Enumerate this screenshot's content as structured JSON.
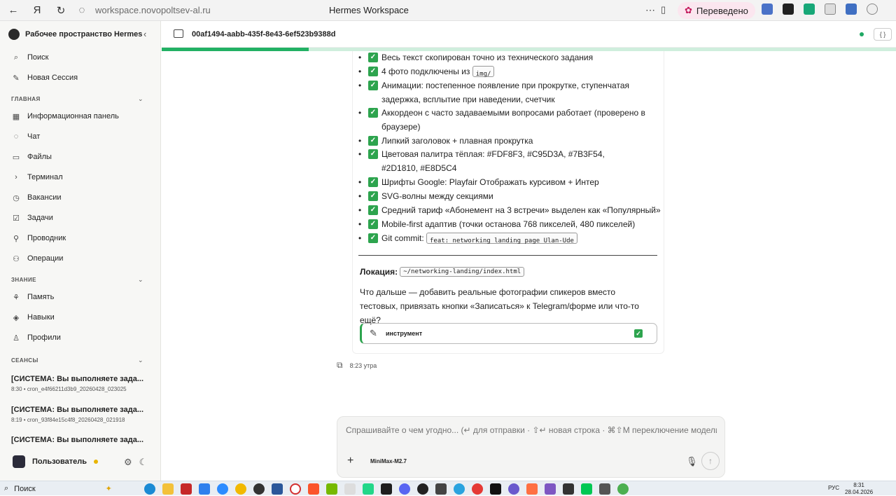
{
  "browser": {
    "url": "workspace.novopoltsev-al.ru",
    "title": "Hermes Workspace",
    "translated_label": "Переведено"
  },
  "sidebar": {
    "workspace_title": "Рабочее пространство Hermes",
    "top_items": [
      {
        "label": "Поиск",
        "icon": "search-icon"
      },
      {
        "label": "Новая Сессия",
        "icon": "new-session-icon"
      }
    ],
    "main_section": "ГЛАВНАЯ",
    "main_items": [
      {
        "label": "Информационная панель",
        "icon": "dashboard-icon"
      },
      {
        "label": "Чат",
        "icon": "chat-icon"
      },
      {
        "label": "Файлы",
        "icon": "files-icon"
      },
      {
        "label": "Терминал",
        "icon": "terminal-icon"
      },
      {
        "label": "Вакансии",
        "icon": "clock-icon"
      },
      {
        "label": "Задачи",
        "icon": "tasks-icon"
      },
      {
        "label": "Проводник",
        "icon": "explorer-icon"
      },
      {
        "label": "Операции",
        "icon": "operations-icon"
      }
    ],
    "knowledge_section": "ЗНАНИЕ",
    "knowledge_items": [
      {
        "label": "Память",
        "icon": "memory-icon"
      },
      {
        "label": "Навыки",
        "icon": "skills-icon"
      },
      {
        "label": "Профили",
        "icon": "profiles-icon"
      }
    ],
    "sessions_section": "СЕАНСЫ",
    "sessions": [
      {
        "title": "[СИСТЕМА: Вы выполняете зада...",
        "meta": "8:30 • cron_e4f66211d3b9_20260428_023025"
      },
      {
        "title": "[СИСТЕМА: Вы выполняете зада...",
        "meta": "8:19 • cron_93f84e15c4f8_20260428_021918"
      },
      {
        "title": "[СИСТЕМА: Вы выполняете зада...",
        "meta": ""
      }
    ],
    "user_label": "Пользователь"
  },
  "session": {
    "id": "00af1494-aabb-435f-8e43-6ef523b9388d",
    "progress": 0.2
  },
  "message": {
    "checklist": [
      {
        "text": "Весь текст скопирован точно из технического задания"
      },
      {
        "text": "4 фото подключены из",
        "code": "img/"
      },
      {
        "text": "Анимации: постепенное появление при прокрутке, ступенчатая задержка, всплытие при наведении, счетчик"
      },
      {
        "text": "Аккордеон с часто задаваемыми вопросами работает (проверено в браузере)"
      },
      {
        "text": "Липкий заголовок + плавная прокрутка"
      },
      {
        "text": "Цветовая палитра тёплая: #FDF8F3, #C95D3A, #7B3F54, #2D1810, #E8D5C4"
      },
      {
        "text": "Шрифты Google: Playfair Отображать курсивом + Интер"
      },
      {
        "text": "SVG-волны между секциями"
      },
      {
        "text": "Средний тариф «Абонемент на 3 встречи» выделен как «Популярный»"
      },
      {
        "text": "Mobile-first адаптив (точки останова 768 пикселей, 480 пикселей)"
      },
      {
        "text": "Git commit:",
        "code": "feat: networking landing page Ulan-Ude"
      }
    ],
    "location_label": "Локация:",
    "location_path": "~/networking-landing/index.html",
    "next_question": "Что дальше — добавить реальные фотографии спикеров вместо тестовых, привязать кнопки «Записаться» к Telegram/форме или что-то ещё?",
    "tool_label": "инструмент",
    "time": "8:23 утра"
  },
  "composer": {
    "placeholder": "Спрашивайте о чем угодно... (↵ для отправки · ⇧↵ новая строка · ⌘⇧M переключение модели)",
    "model": "MiniMax-M2.7"
  },
  "taskbar": {
    "search_label": "Поиск",
    "language": "РУС",
    "time": "8:31",
    "date": "28.04.2026"
  },
  "colors": {
    "accent_green": "#22b164",
    "check_green": "#2da44e",
    "translated_bg": "#fbe6ef"
  }
}
